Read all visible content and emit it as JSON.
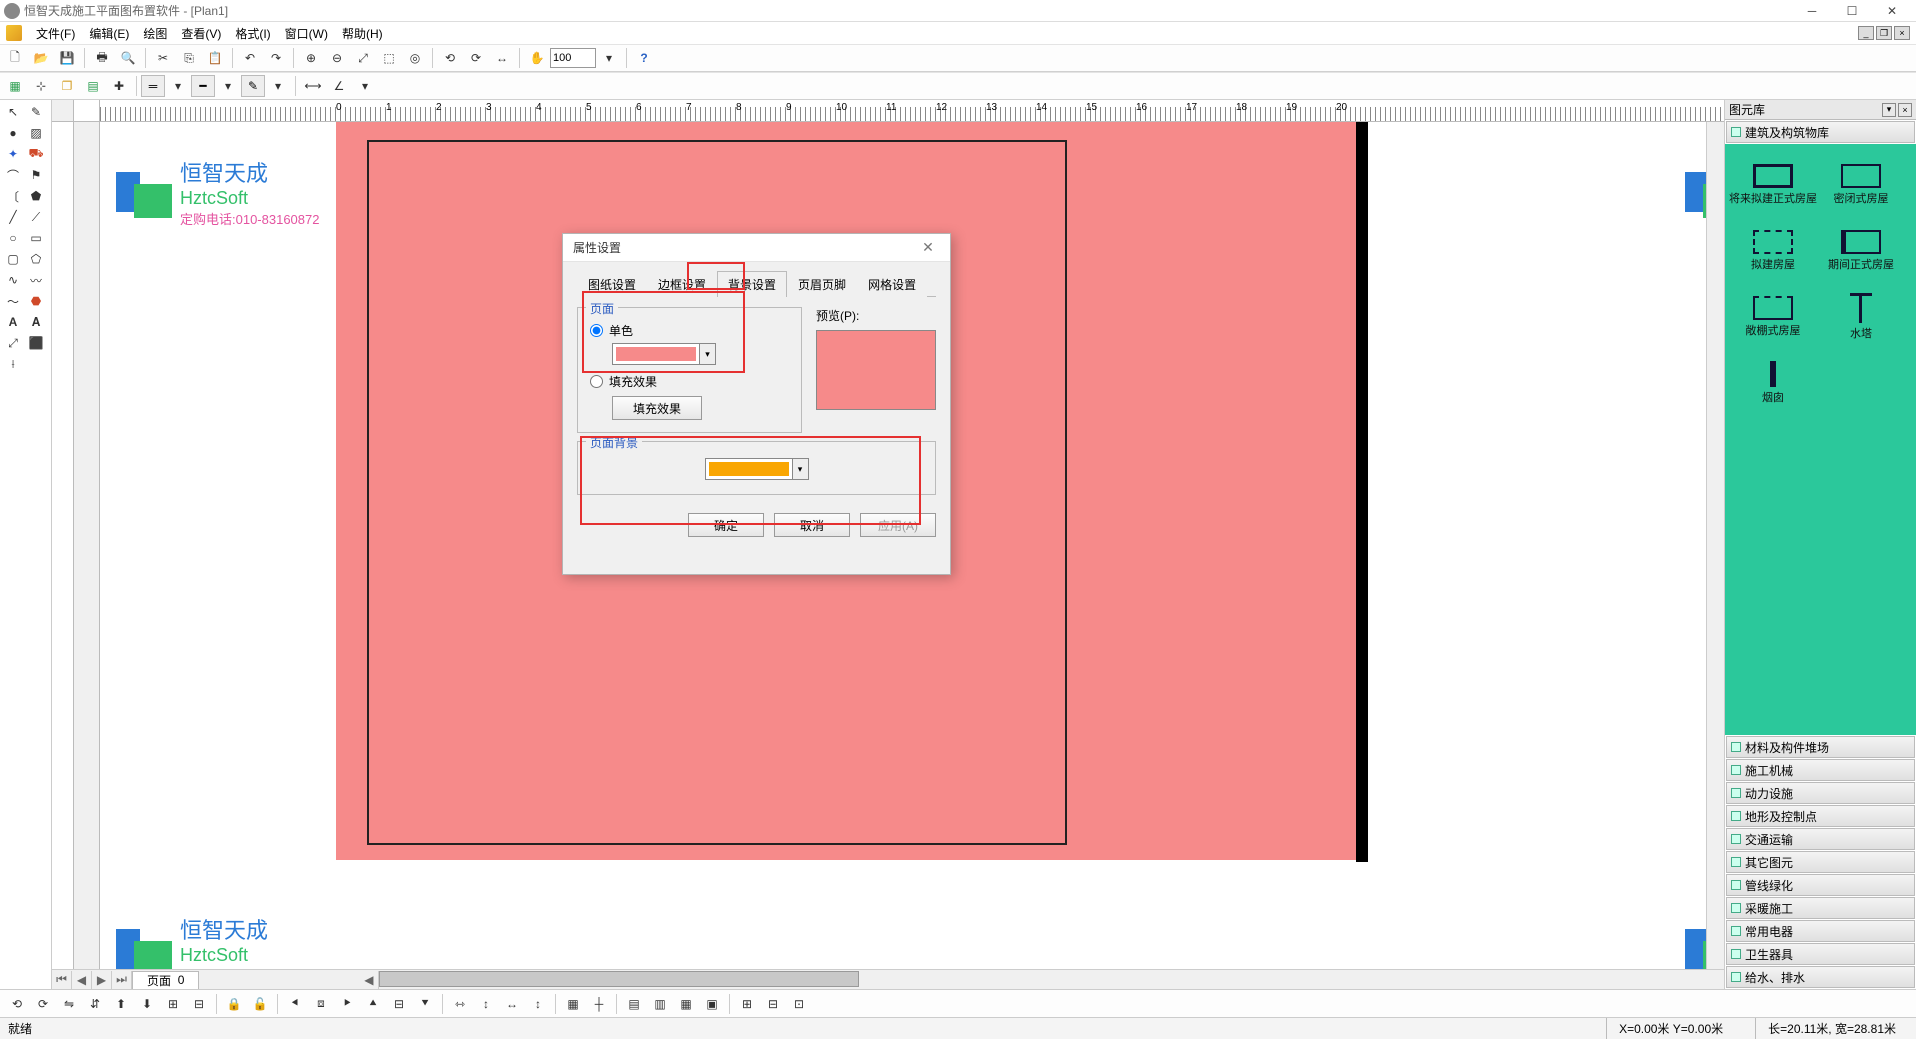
{
  "title_bar": {
    "app_title": "恒智天成施工平面图布置软件 - [Plan1]"
  },
  "menu": {
    "file": "文件(F)",
    "edit": "编辑(E)",
    "draw": "绘图",
    "view": "查看(V)",
    "format": "格式(I)",
    "window": "窗口(W)",
    "help": "帮助(H)"
  },
  "toolbar": {
    "zoom_value": "100"
  },
  "watermark": {
    "brand_cn": "恒智天成",
    "brand_en": "HztcSoft",
    "phone": "定购电话:010-83160872"
  },
  "ruler": {
    "labels": [
      "0",
      "1",
      "2",
      "3",
      "4",
      "5",
      "6",
      "7",
      "8",
      "9",
      "10",
      "11",
      "12",
      "13",
      "14",
      "15",
      "16",
      "17",
      "18",
      "19",
      "20"
    ]
  },
  "page_tabs": {
    "label": "页面",
    "index": "0"
  },
  "library": {
    "title": "图元库",
    "active_category": "建筑及构筑物库",
    "items": [
      {
        "label": "将来拟建正式房屋"
      },
      {
        "label": "密闭式房屋"
      },
      {
        "label": "拟建房屋"
      },
      {
        "label": "期间正式房屋"
      },
      {
        "label": "敞棚式房屋"
      },
      {
        "label": "水塔"
      },
      {
        "label": "烟囱"
      }
    ],
    "categories": [
      "材料及构件堆场",
      "施工机械",
      "动力设施",
      "地形及控制点",
      "交通运输",
      "其它图元",
      "管线绿化",
      "采暖施工",
      "常用电器",
      "卫生器具",
      "给水、排水"
    ]
  },
  "dialog": {
    "title": "属性设置",
    "tabs": {
      "t1": "图纸设置",
      "t2": "边框设置",
      "t3": "背景设置",
      "t4": "页眉页脚",
      "t5": "网格设置"
    },
    "group_page": "页面",
    "radio_solid": "单色",
    "radio_fill": "填充效果",
    "btn_fill_effect": "填充效果",
    "preview_label": "预览(P):",
    "group_bg": "页面背景",
    "btn_ok": "确定",
    "btn_cancel": "取消",
    "btn_apply": "应用(A)",
    "color_page": "#f68a8a",
    "color_bg": "#f9a602"
  },
  "status": {
    "ready": "就绪",
    "coords": "X=0.00米 Y=0.00米",
    "size": "长=20.11米, 宽=28.81米"
  }
}
